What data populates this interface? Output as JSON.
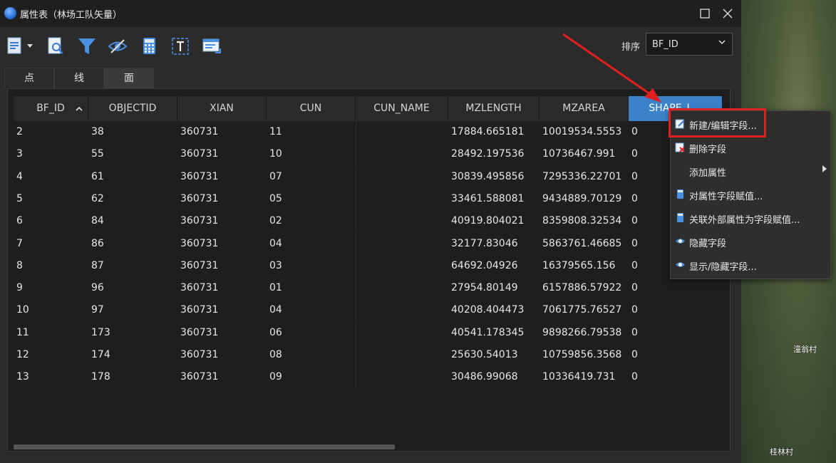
{
  "window": {
    "title": "属性表（林场工队矢量）"
  },
  "toolbar": {
    "sort_label": "排序",
    "sort_value": "BF_ID"
  },
  "tabs": [
    {
      "label": "点"
    },
    {
      "label": "线"
    },
    {
      "label": "面"
    }
  ],
  "table": {
    "columns": [
      "BF_ID",
      "OBJECTID",
      "XIAN",
      "CUN",
      "CUN_NAME",
      "MZLENGTH",
      "MZAREA",
      "SHAPE_L..."
    ],
    "rows": [
      [
        "2",
        "38",
        "360731",
        "11",
        "",
        "17884.665181",
        "10019534.5553",
        "0"
      ],
      [
        "3",
        "55",
        "360731",
        "10",
        "",
        "28492.197536",
        "10736467.991",
        "0"
      ],
      [
        "4",
        "61",
        "360731",
        "07",
        "",
        "30839.495856",
        "7295336.22701",
        "0"
      ],
      [
        "5",
        "62",
        "360731",
        "05",
        "",
        "33461.588081",
        "9434889.70129",
        "0"
      ],
      [
        "6",
        "84",
        "360731",
        "02",
        "",
        "40919.804021",
        "8359808.32534",
        "0"
      ],
      [
        "7",
        "86",
        "360731",
        "04",
        "",
        "32177.83046",
        "5863761.46685",
        "0"
      ],
      [
        "8",
        "87",
        "360731",
        "03",
        "",
        "64692.04926",
        "16379565.156",
        "0"
      ],
      [
        "9",
        "96",
        "360731",
        "01",
        "",
        "27954.80149",
        "6157886.57922",
        "0"
      ],
      [
        "10",
        "97",
        "360731",
        "04",
        "",
        "40208.404473",
        "7061775.76527",
        "0"
      ],
      [
        "11",
        "173",
        "360731",
        "06",
        "",
        "40541.178345",
        "9898266.79538",
        "0"
      ],
      [
        "12",
        "174",
        "360731",
        "08",
        "",
        "25630.54013",
        "10759856.3568",
        "0"
      ],
      [
        "13",
        "178",
        "360731",
        "09",
        "",
        "30486.99068",
        "10336419.731",
        "0"
      ]
    ]
  },
  "context_menu": {
    "items": [
      {
        "label": "新建/编辑字段...",
        "icon": "edit-field-icon"
      },
      {
        "label": "删除字段",
        "icon": "delete-field-icon"
      },
      {
        "label": "添加属性",
        "icon": ""
      },
      {
        "label": "对属性字段赋值...",
        "icon": "calculator-icon"
      },
      {
        "label": "关联外部属性为字段赋值...",
        "icon": "calculator-icon"
      },
      {
        "label": "隐藏字段",
        "icon": "eye-icon"
      },
      {
        "label": "显示/隐藏字段...",
        "icon": "eye-icon"
      }
    ]
  },
  "map": {
    "labels": [
      "潼翁村",
      "桂林村"
    ]
  },
  "colors": {
    "accent": "#3b82c9",
    "highlight": "#e02020"
  }
}
